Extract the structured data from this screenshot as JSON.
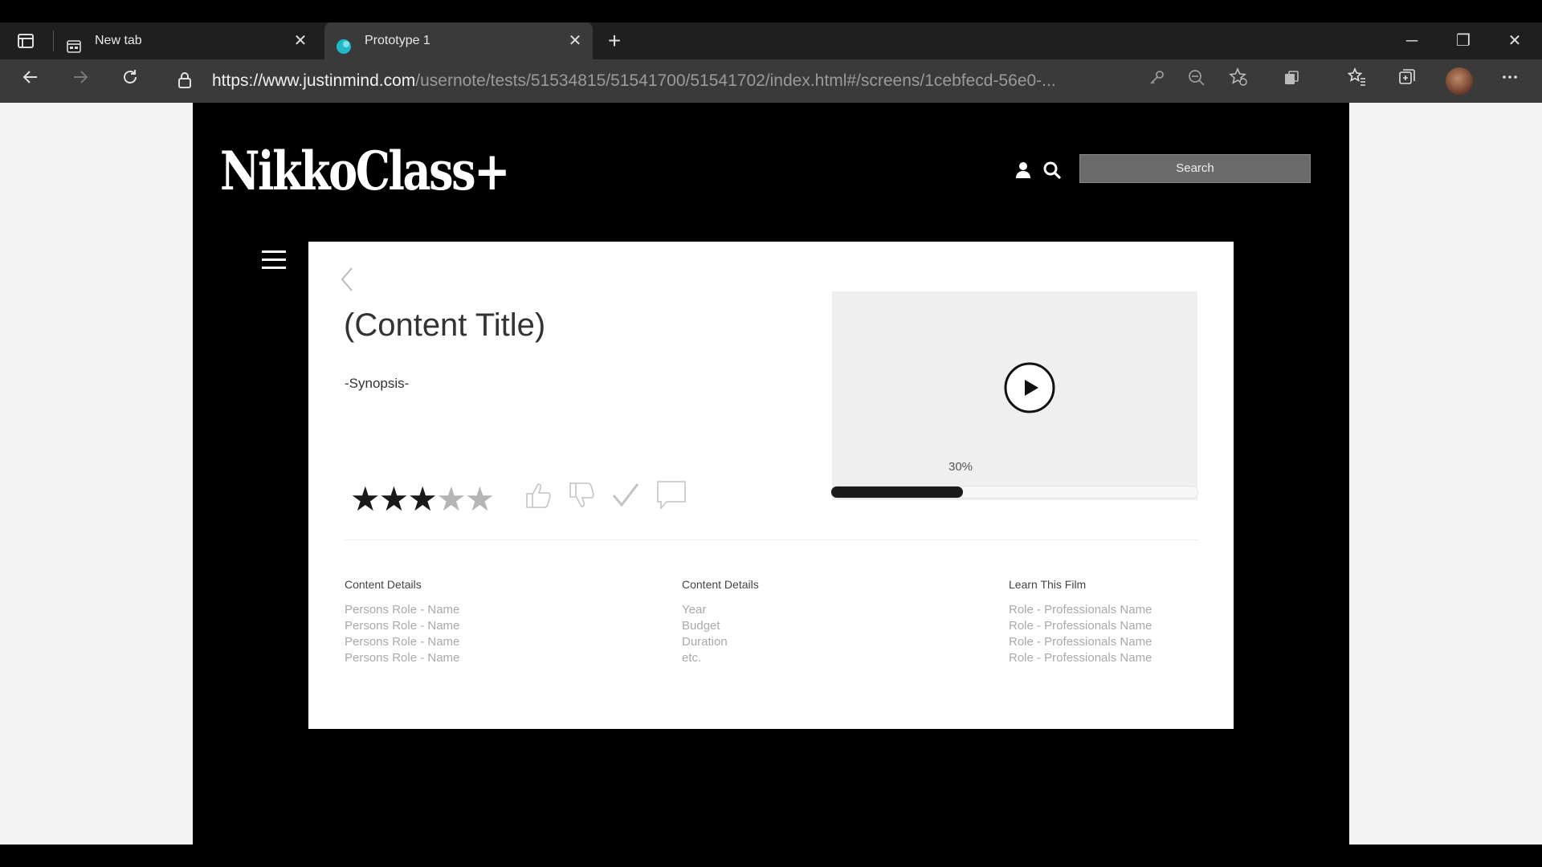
{
  "browser": {
    "tabs": [
      {
        "label": "New tab",
        "active": false
      },
      {
        "label": "Prototype 1",
        "active": true
      }
    ],
    "close_glyph": "✕",
    "new_tab_glyph": "+",
    "url_host": "https://www.justinmind.com",
    "url_path": "/usernote/tests/51534815/51541700/51541702/index.html#/screens/1cebfecd-56e0-...",
    "window_controls": {
      "minimize": "─",
      "restore": "❐",
      "close": "✕"
    },
    "toolbar_icons": [
      "back-arrow-icon",
      "forward-arrow-icon",
      "refresh-icon",
      "lock-icon",
      "key-icon",
      "zoom-out-icon",
      "favorite-add-icon",
      "extensions-icon",
      "favorites-icon",
      "collections-icon",
      "profile-avatar",
      "more-icon"
    ]
  },
  "site": {
    "logo": "NikkoClass+",
    "search_placeholder": "Search"
  },
  "content": {
    "title": "(Content Title)",
    "synopsis": "-Synopsis-",
    "rating": {
      "value": 3,
      "max": 5
    },
    "video": {
      "progress_label": "30%",
      "progress": 0.36
    }
  },
  "details": [
    {
      "heading": "Content Details",
      "lines": [
        "Persons Role - Name",
        "Persons Role - Name",
        "Persons Role - Name",
        "Persons Role - Name"
      ]
    },
    {
      "heading": "Content Details",
      "lines": [
        "Year",
        "Budget",
        "Duration",
        "etc."
      ]
    },
    {
      "heading": "Learn This Film",
      "lines": [
        "Role - Professionals Name",
        "Role - Professionals Name",
        "Role - Professionals Name",
        "Role - Professionals Name"
      ]
    }
  ],
  "colors": {
    "brand_bg": "#000000",
    "card_bg": "#ffffff",
    "progress_fill": "#1a1a1a",
    "chrome_bg": "#3a3a3a"
  }
}
